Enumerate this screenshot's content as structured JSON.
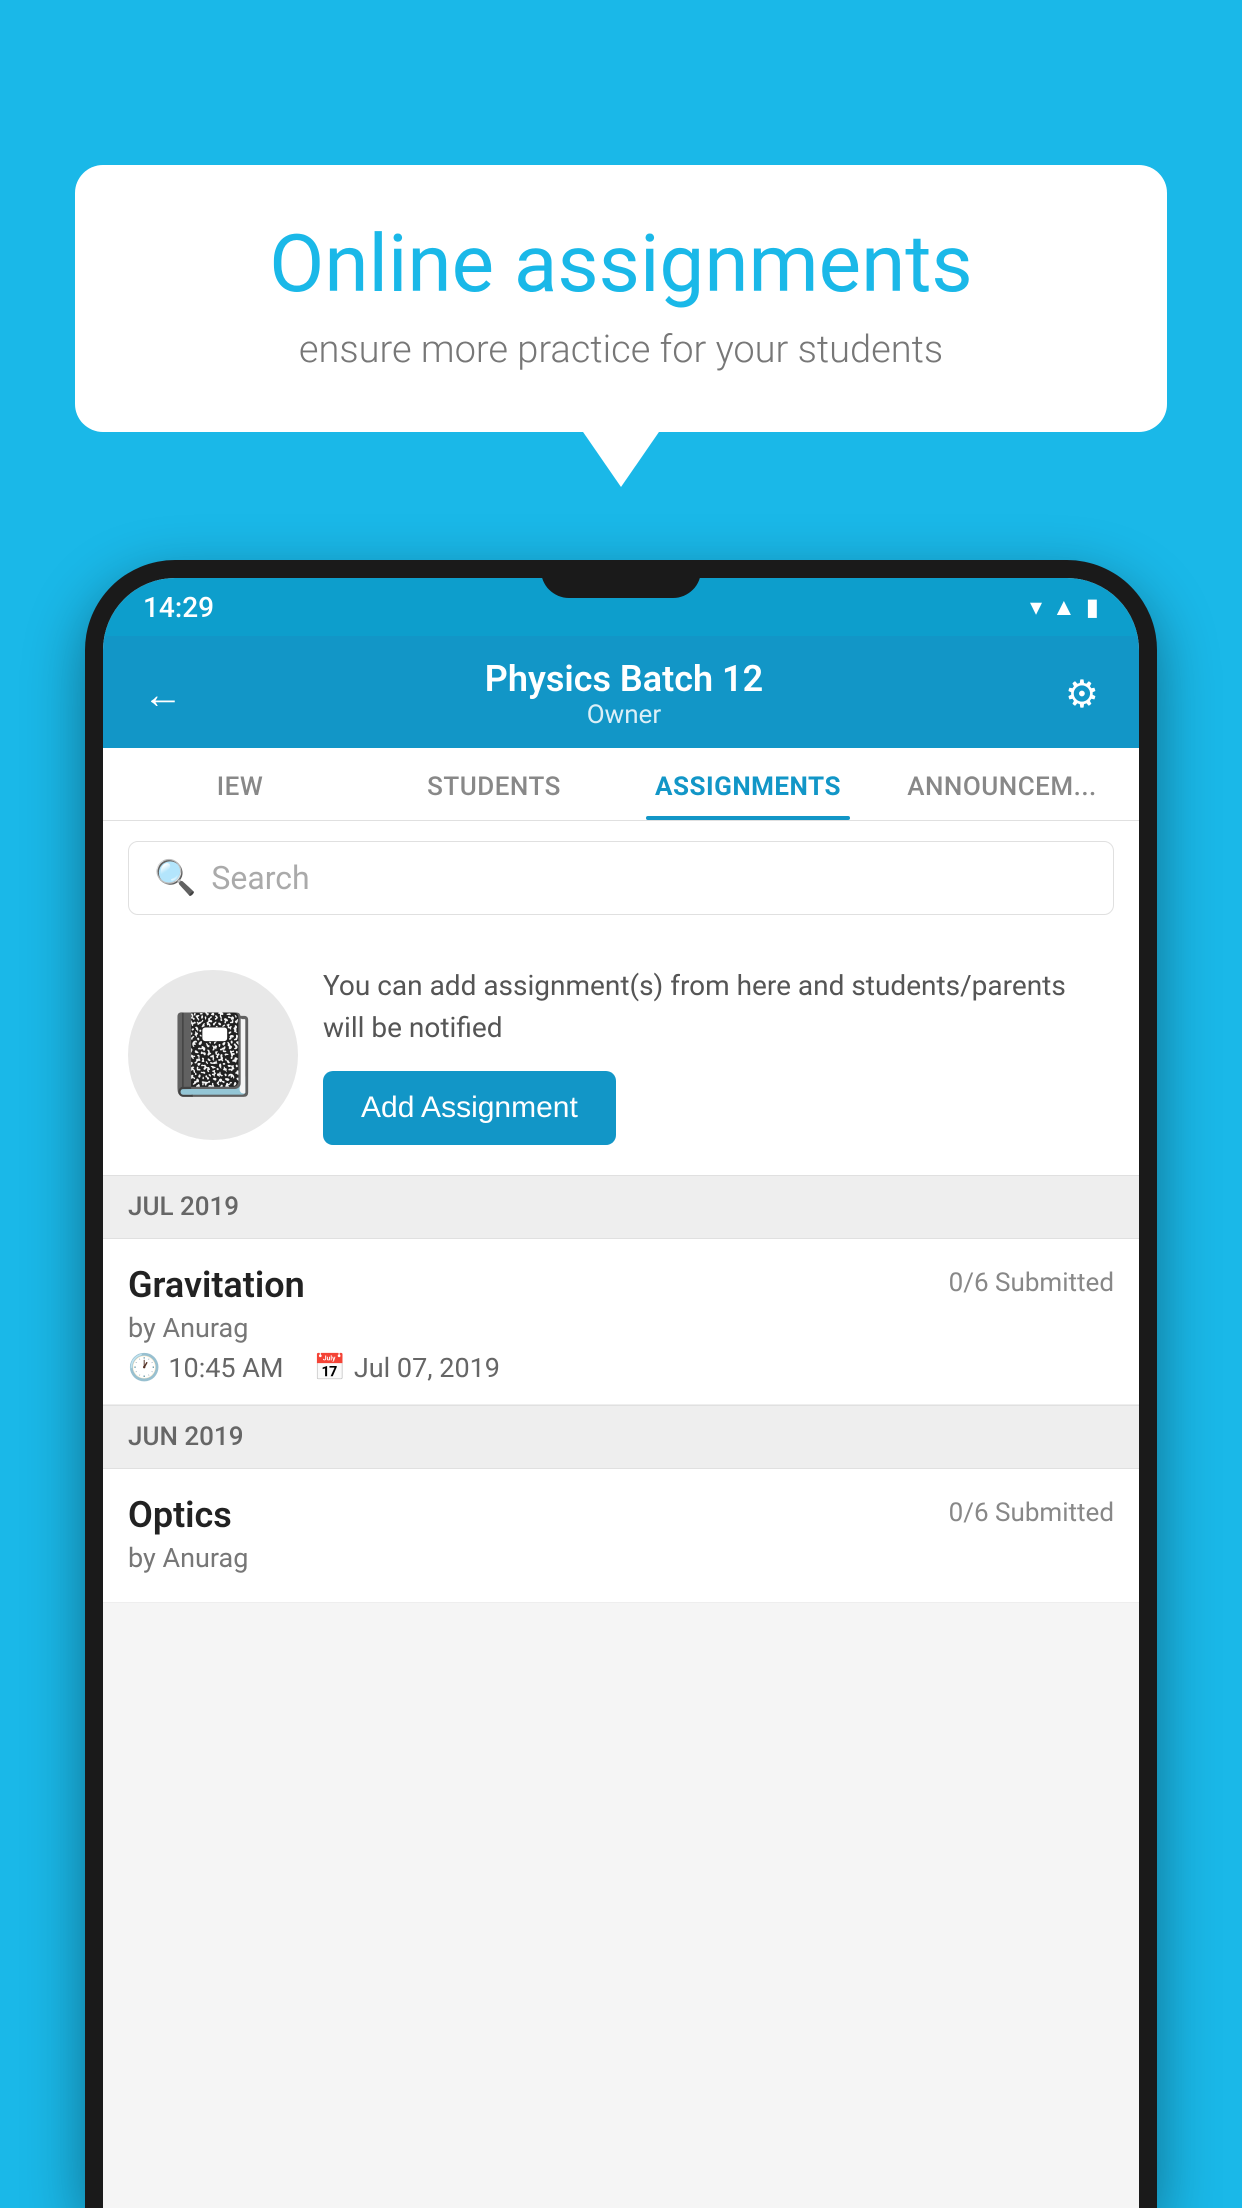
{
  "background_color": "#1ab8e8",
  "speech_bubble": {
    "title": "Online assignments",
    "subtitle": "ensure more practice for your students"
  },
  "status_bar": {
    "time": "14:29",
    "icons": [
      "wifi",
      "signal",
      "battery"
    ]
  },
  "header": {
    "title": "Physics Batch 12",
    "subtitle": "Owner",
    "back_label": "←",
    "gear_label": "⚙"
  },
  "tabs": [
    {
      "label": "IEW",
      "active": false
    },
    {
      "label": "STUDENTS",
      "active": false
    },
    {
      "label": "ASSIGNMENTS",
      "active": true
    },
    {
      "label": "ANNOUNCEMENTS",
      "active": false
    }
  ],
  "search": {
    "placeholder": "Search"
  },
  "info_card": {
    "description": "You can add assignment(s) from here and students/parents will be notified",
    "button_label": "Add Assignment"
  },
  "sections": [
    {
      "header": "JUL 2019",
      "assignments": [
        {
          "name": "Gravitation",
          "submitted": "0/6 Submitted",
          "by": "by Anurag",
          "time": "10:45 AM",
          "date": "Jul 07, 2019"
        }
      ]
    },
    {
      "header": "JUN 2019",
      "assignments": [
        {
          "name": "Optics",
          "submitted": "0/6 Submitted",
          "by": "by Anurag",
          "time": "",
          "date": ""
        }
      ]
    }
  ]
}
